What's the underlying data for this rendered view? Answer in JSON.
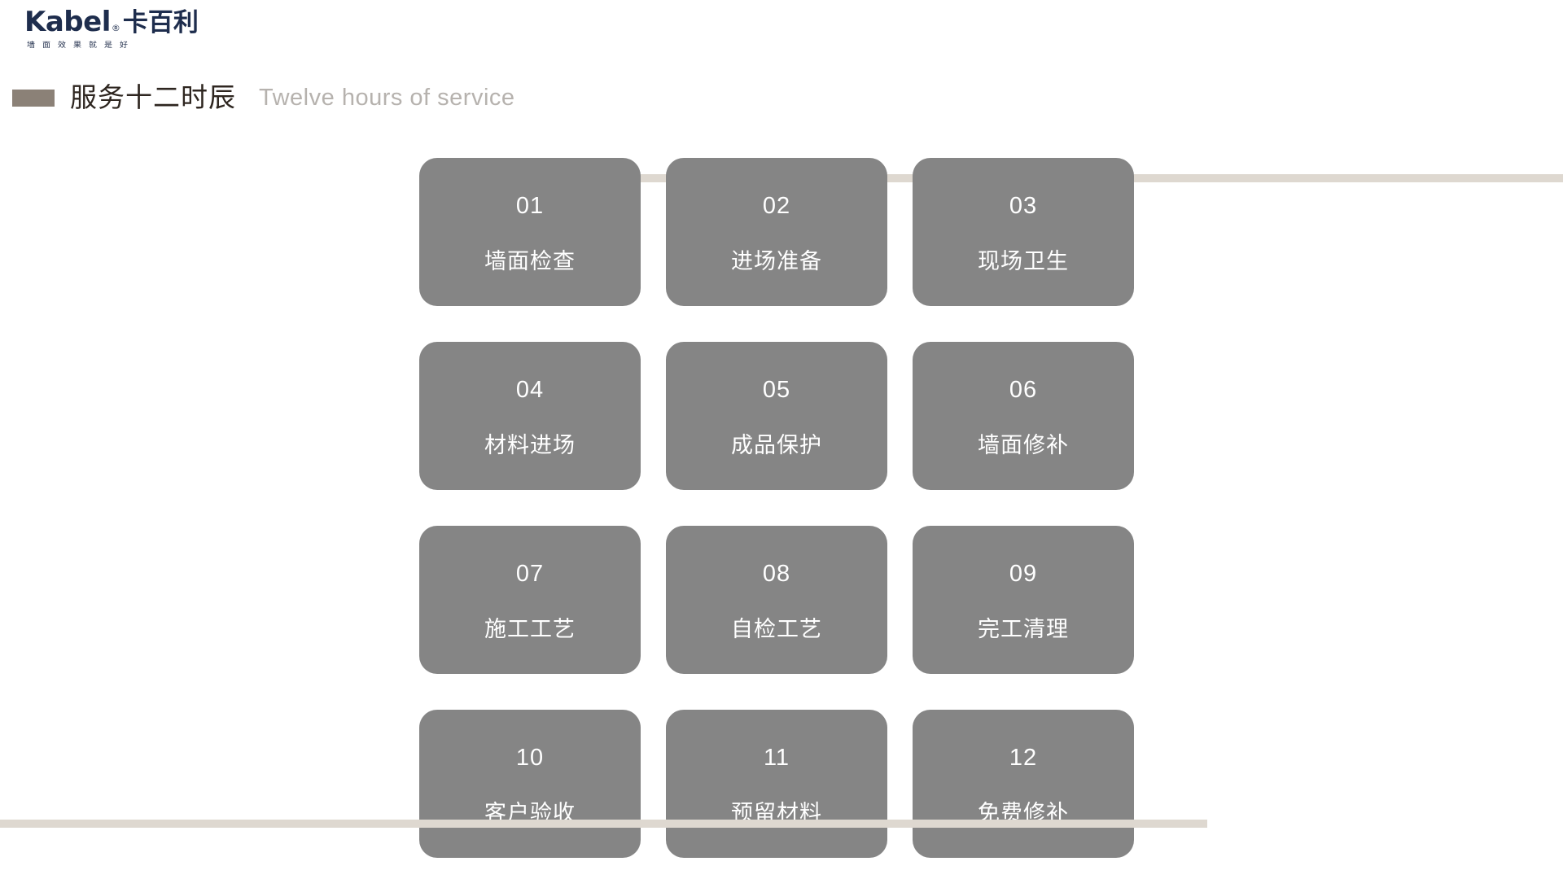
{
  "brand": {
    "latin_name": "Kabel",
    "registered_mark": "®",
    "chinese_name": "卡百利",
    "tagline": "墙面效果就是好",
    "color": "#1e2d4d"
  },
  "section": {
    "title_cn": "服务十二时辰",
    "title_en": "Twelve hours of service",
    "accent_color": "#8b8177",
    "rule_color": "#ded8d0"
  },
  "grid": {
    "card_color": "#858585",
    "card_text_color": "#ffffff",
    "cards": [
      {
        "number": "01",
        "label": "墙面检查"
      },
      {
        "number": "02",
        "label": "进场准备"
      },
      {
        "number": "03",
        "label": "现场卫生"
      },
      {
        "number": "04",
        "label": "材料进场"
      },
      {
        "number": "05",
        "label": "成品保护"
      },
      {
        "number": "06",
        "label": "墙面修补"
      },
      {
        "number": "07",
        "label": "施工工艺"
      },
      {
        "number": "08",
        "label": "自检工艺"
      },
      {
        "number": "09",
        "label": "完工清理"
      },
      {
        "number": "10",
        "label": "客户验收"
      },
      {
        "number": "11",
        "label": "预留材料"
      },
      {
        "number": "12",
        "label": "免费修补"
      }
    ]
  }
}
